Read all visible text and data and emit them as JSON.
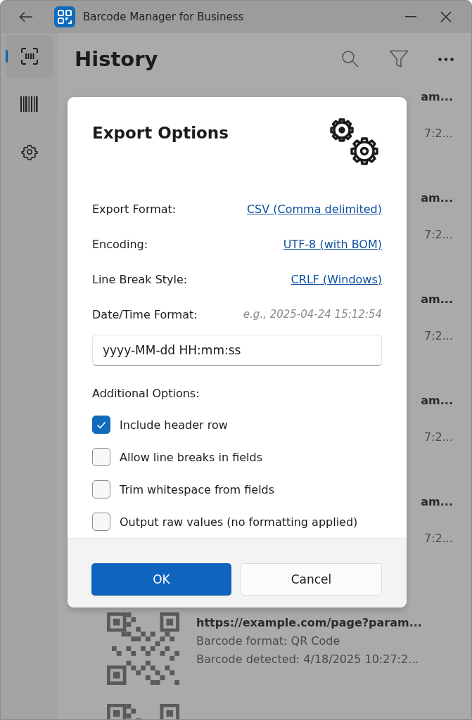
{
  "window": {
    "title": "Barcode Manager for Business"
  },
  "nav": [
    {
      "kind": "scan",
      "selected": true
    },
    {
      "kind": "barcode",
      "selected": false
    },
    {
      "kind": "settings",
      "selected": false
    }
  ],
  "page": {
    "title": "History"
  },
  "history": [
    {
      "kind": "covered",
      "title": "am...",
      "detail": "7:2..."
    },
    {
      "kind": "covered",
      "title": "am...",
      "detail": "7:2..."
    },
    {
      "kind": "covered",
      "title": "am...",
      "detail": "7:2..."
    },
    {
      "kind": "covered",
      "title": "am...",
      "detail": "7:2..."
    },
    {
      "kind": "covered",
      "title": "am...",
      "detail": "7:2..."
    },
    {
      "kind": "full",
      "title": "https://example.com/page?param...",
      "format": "Barcode format: QR Code",
      "detected": "Barcode detected: 4/18/2025 10:27:2..."
    },
    {
      "kind": "thumb"
    }
  ],
  "dialog": {
    "title": "Export Options",
    "settings": [
      {
        "label": "Export Format:",
        "value": "CSV (Comma delimited)"
      },
      {
        "label": "Encoding:",
        "value": "UTF-8 (with BOM)"
      },
      {
        "label": "Line Break Style:",
        "value": "CRLF (Windows)"
      }
    ],
    "datetime": {
      "label": "Date/Time Format:",
      "example": "e.g., 2025-04-24 15:12:54",
      "value": "yyyy-MM-dd HH:mm:ss"
    },
    "options_label": "Additional Options:",
    "options": [
      {
        "label": "Include header row",
        "checked": true
      },
      {
        "label": "Allow line breaks in fields",
        "checked": false
      },
      {
        "label": "Trim whitespace from fields",
        "checked": false
      },
      {
        "label": "Output raw values (no formatting applied)",
        "checked": false
      }
    ],
    "buttons": [
      {
        "label": "OK",
        "kind": "primary"
      },
      {
        "label": "Cancel",
        "kind": "secondary"
      }
    ]
  }
}
